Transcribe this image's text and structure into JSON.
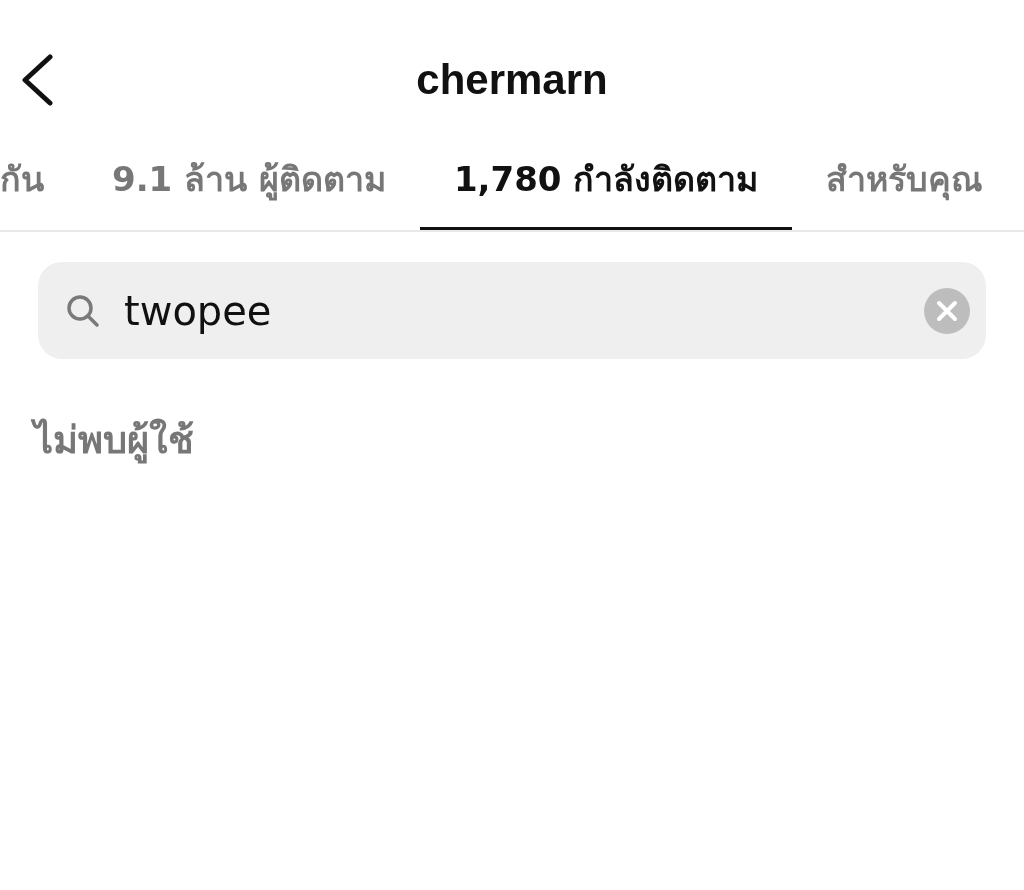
{
  "header": {
    "title": "chermarn"
  },
  "tabs": [
    {
      "label": "กัน",
      "selected": false
    },
    {
      "label": "9.1 ล้าน ผู้ติดตาม",
      "selected": false
    },
    {
      "label": "1,780 กำลังติดตาม",
      "selected": true
    },
    {
      "label": "สำหรับคุณ",
      "selected": false
    }
  ],
  "search": {
    "value": "twopee"
  },
  "message": "ไม่พบผู้ใช้"
}
